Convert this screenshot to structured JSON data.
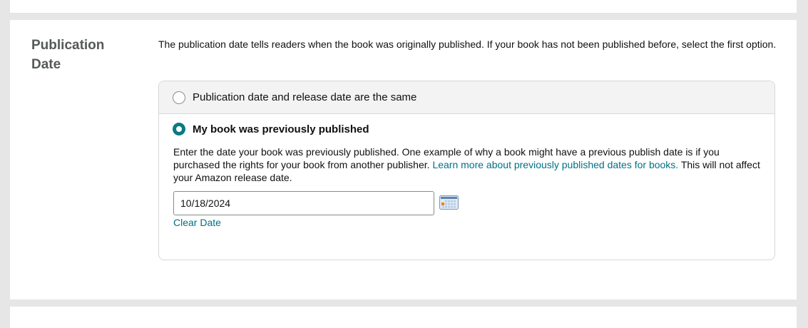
{
  "publication_date": {
    "title": "Publication Date",
    "description": "The publication date tells readers when the book was originally published. If your book has not been published before, select the first option.",
    "options": [
      {
        "label": "Publication date and release date are the same",
        "selected": false
      },
      {
        "label": "My book was previously published",
        "selected": true
      }
    ],
    "previous": {
      "description_before": "Enter the date your book was previously published. One example of why a book might have a previous publish date is if you purchased the rights for your book from another publisher. ",
      "learn_more_link": "Learn more about previously published dates for books.",
      "description_after": " This will not affect your Amazon release date.",
      "date_value": "10/18/2024",
      "clear_date_label": "Clear Date",
      "calendar_icon": "calendar-icon"
    }
  },
  "colors": {
    "accent": "#0a7b83",
    "link": "#007185",
    "page_background": "#e6e6e6",
    "card_background": "#ffffff",
    "option_background": "#f3f3f3"
  }
}
